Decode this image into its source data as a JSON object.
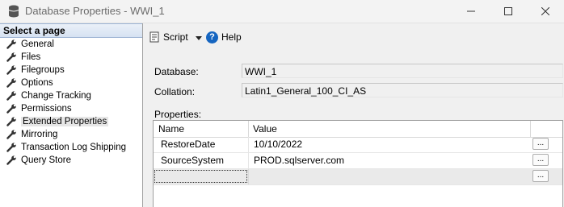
{
  "window": {
    "title": "Database Properties - WWI_1"
  },
  "sidebar": {
    "header": "Select a page",
    "items": [
      {
        "label": "General"
      },
      {
        "label": "Files"
      },
      {
        "label": "Filegroups"
      },
      {
        "label": "Options"
      },
      {
        "label": "Change Tracking"
      },
      {
        "label": "Permissions"
      },
      {
        "label": "Extended Properties",
        "selected": true
      },
      {
        "label": "Mirroring"
      },
      {
        "label": "Transaction Log Shipping"
      },
      {
        "label": "Query Store"
      }
    ]
  },
  "toolbar": {
    "script_label": "Script",
    "help_label": "Help"
  },
  "form": {
    "database_label": "Database:",
    "database_value": "WWI_1",
    "collation_label": "Collation:",
    "collation_value": "Latin1_General_100_CI_AS",
    "properties_label": "Properties:"
  },
  "grid": {
    "columns": [
      "Name",
      "Value"
    ],
    "rows": [
      {
        "name": "RestoreDate",
        "value": "10/10/2022",
        "button": "..."
      },
      {
        "name": "SourceSystem",
        "value": "PROD.sqlserver.com",
        "button": "..."
      },
      {
        "name": "",
        "value": "",
        "button": "..."
      }
    ]
  },
  "colors": {
    "selected_item_bg": "#e6e6e6",
    "help_icon": "#1565c0",
    "new_row_bg": "#eaeaea"
  }
}
